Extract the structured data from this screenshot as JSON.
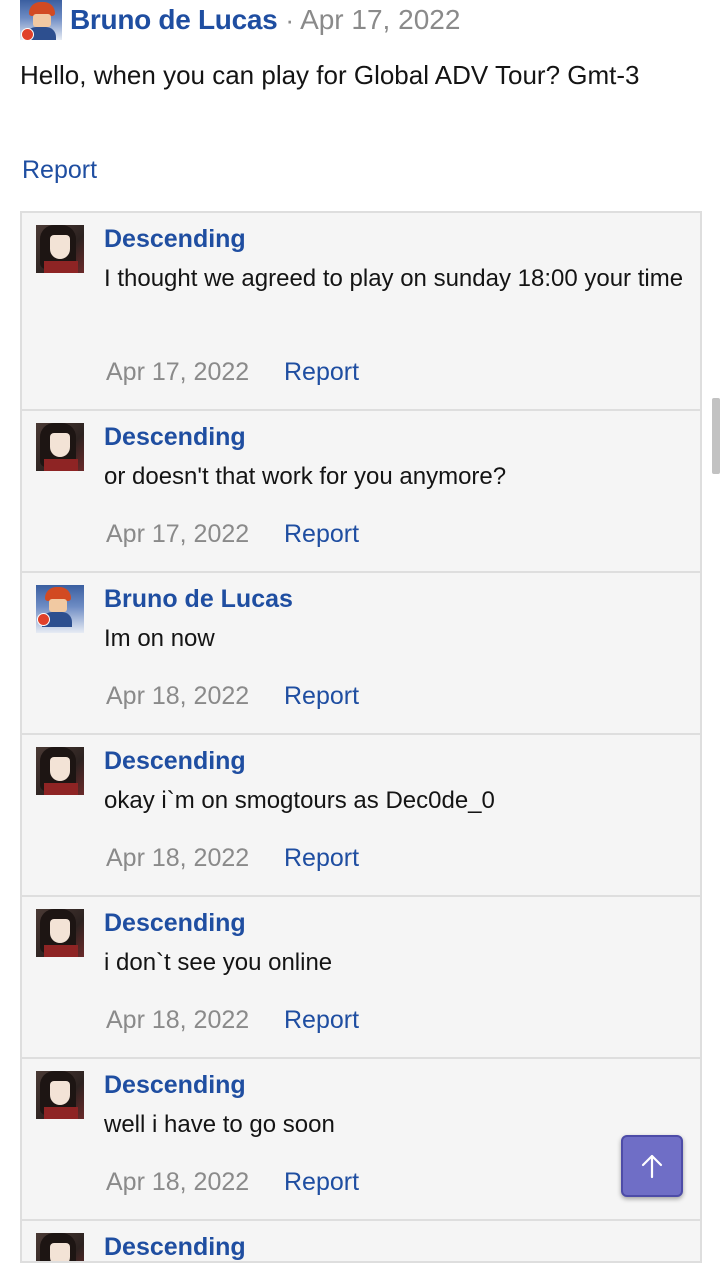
{
  "post": {
    "author": "Bruno de Lucas",
    "separator": "·",
    "date": "Apr 17, 2022",
    "message": "Hello, when you can play for Global ADV Tour? Gmt-3",
    "report_label": "Report"
  },
  "replies": [
    {
      "author": "Descending",
      "text": "I thought we agreed to play on sunday 18:00 your time",
      "date": "Apr 17, 2022",
      "report": "Report"
    },
    {
      "author": "Descending",
      "text": "or doesn't that work for you anymore?",
      "date": "Apr 17, 2022",
      "report": "Report"
    },
    {
      "author": "Bruno de Lucas",
      "text": "Im on now",
      "date": "Apr 18, 2022",
      "report": "Report"
    },
    {
      "author": "Descending",
      "text": "okay i`m on smogtours as Dec0de_0",
      "date": "Apr 18, 2022",
      "report": "Report"
    },
    {
      "author": "Descending",
      "text": "i don`t see you online",
      "date": "Apr 18, 2022",
      "report": "Report"
    },
    {
      "author": "Descending",
      "text": "well i have to go soon",
      "date": "Apr 18, 2022",
      "report": "Report"
    },
    {
      "author": "Descending"
    }
  ],
  "icons": {
    "scroll_top": "arrow-up-icon",
    "accent_color": "#6f6ec6",
    "link_color": "#1f4ea1"
  }
}
